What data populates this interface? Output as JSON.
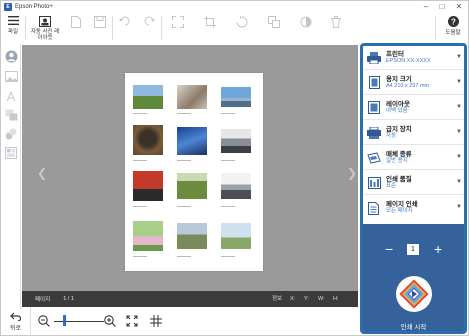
{
  "window": {
    "title": "Epson Photo+",
    "minimize": "–",
    "maximize": "□",
    "close": "✕"
  },
  "toolbar": {
    "file_label": "파일",
    "auto_photo_label_1": "자동 사진 레",
    "auto_photo_label_2": "이아웃",
    "help_label": "도움말"
  },
  "sidebar": {
    "icons": [
      "person-icon",
      "photo-icon",
      "text-icon",
      "frame-icon",
      "stamp-icon",
      "layout-icon"
    ]
  },
  "status": {
    "page_label": "페이지",
    "page_value": "1 / 1",
    "info_label": "정보",
    "x_label": "X:",
    "y_label": "Y:",
    "w_label": "W:",
    "h_label": "H:"
  },
  "bottom": {
    "back_label": "뒤로"
  },
  "settings": [
    {
      "label": "프린터",
      "value": "EPSON XX-XXXX",
      "icon": "printer-icon"
    },
    {
      "label": "용지 크기",
      "value": "A4 210 x 297 mm",
      "icon": "paper-size-icon"
    },
    {
      "label": "레이아웃",
      "value": "여백 있음",
      "icon": "layout-borders-icon"
    },
    {
      "label": "급지 장치",
      "value": "자동",
      "icon": "paper-source-icon"
    },
    {
      "label": "매체 종류",
      "value": "일반 용지",
      "icon": "media-type-icon"
    },
    {
      "label": "인쇄 품질",
      "value": "표준",
      "icon": "print-quality-icon"
    },
    {
      "label": "페이지 인쇄",
      "value": "모든 페이지",
      "icon": "print-pages-icon"
    }
  ],
  "print": {
    "minus": "−",
    "plus": "+",
    "copies": "1",
    "start_label": "인쇄 시작"
  },
  "colors": {
    "accent": "#2e6dad",
    "print_panel": "#35629a",
    "canvas": "#9a9a9a",
    "statusbar": "#3b3b3b"
  }
}
